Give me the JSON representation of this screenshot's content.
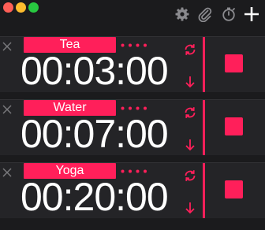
{
  "colors": {
    "accent": "#ff1f5a",
    "background": "#1b1b1d",
    "row_background": "#242427",
    "icon_gray": "#8a8a8e",
    "text": "#ffffff"
  },
  "window_controls": [
    "close",
    "minimize",
    "zoom"
  ],
  "toolbar": {
    "icons": [
      "gear-icon",
      "paperclip-icon",
      "stopwatch-icon",
      "plus-icon"
    ]
  },
  "timers": [
    {
      "label": "Tea",
      "time": "00:03:00"
    },
    {
      "label": "Water",
      "time": "00:07:00"
    },
    {
      "label": "Yoga",
      "time": "00:20:00"
    }
  ]
}
